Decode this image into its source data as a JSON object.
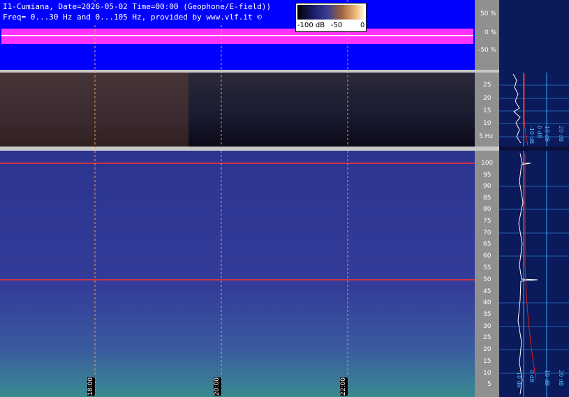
{
  "header": {
    "line1": "I1-Cumiana, Date=2026-05-02 Time=00:00 (Geophone/E-field))",
    "line2": "Freq= 0...30 Hz and 0...105 Hz, provided by www.vlf.it ©"
  },
  "colorbar": {
    "labels": [
      "-100 dB",
      "-50",
      "0"
    ]
  },
  "waveform_axis": {
    "labels": [
      "50 %",
      "0 %",
      "-50 %"
    ]
  },
  "low_freq_axis": {
    "labels": [
      "25",
      "20",
      "15",
      "10",
      "5 Hz"
    ]
  },
  "high_freq_axis": {
    "labels": [
      "100",
      "95",
      "90",
      "85",
      "80",
      "75",
      "70",
      "65",
      "60",
      "55",
      "50",
      "45",
      "40",
      "35",
      "30",
      "25",
      "20",
      "15",
      "10",
      "5"
    ]
  },
  "time_markers": {
    "labels": [
      "18:00",
      "20:00",
      "22:00"
    ]
  },
  "side_axis_top": {
    "labels": [
      "-10 dB",
      "0 dB",
      "10 dB",
      "20 dB"
    ]
  },
  "side_axis_bottom": {
    "labels": [
      "-10 dB",
      "0 dB",
      "10 dB",
      "20 dB"
    ]
  },
  "colors": {
    "waveform_bg": "#0000ff",
    "waveform_trace": "#ff33ff",
    "axis_panel": "#909090",
    "spectrogram_dark": "#0b0e28",
    "spectrogram_blue": "#2d3590",
    "marker_line": "#e8a060",
    "hum_line": "#ff3030",
    "side_bg": "#0a1a5a",
    "side_grid": "#3aa8ff"
  }
}
